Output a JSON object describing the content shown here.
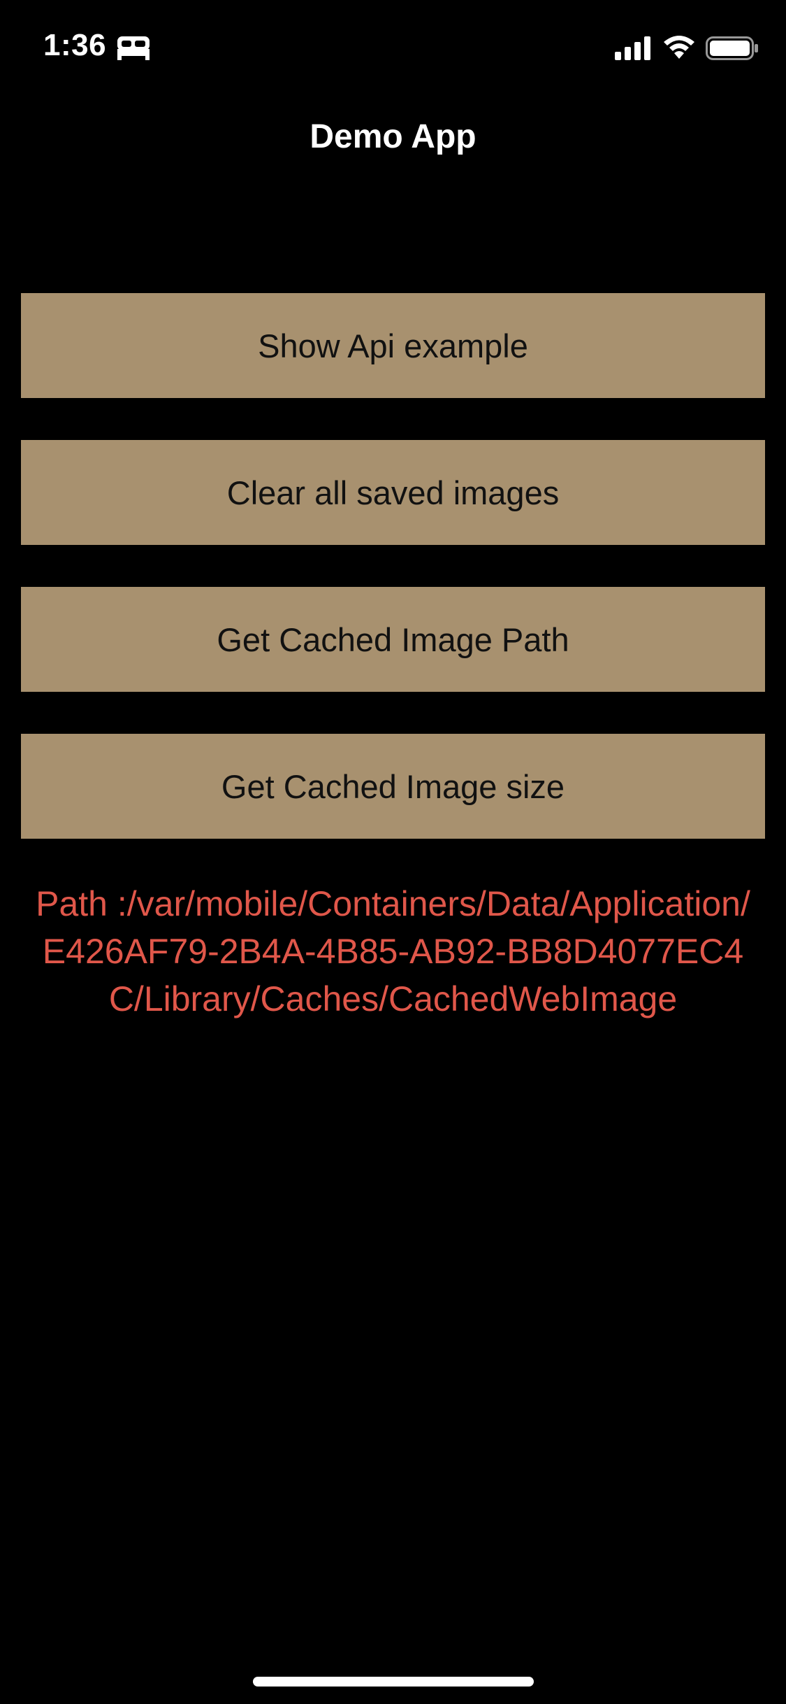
{
  "status_bar": {
    "time": "1:36",
    "icons": [
      "bed-icon",
      "cellular-signal-icon",
      "wifi-icon",
      "battery-icon"
    ]
  },
  "nav": {
    "title": "Demo App"
  },
  "buttons": [
    {
      "label": "Show Api example"
    },
    {
      "label": "Clear all saved images"
    },
    {
      "label": "Get Cached Image Path"
    },
    {
      "label": "Get Cached Image size"
    }
  ],
  "result": {
    "path_text": "Path :/var/mobile/Containers/Data/Application/E426AF79-2B4A-4B85-AB92-BB8D4077EC4C/Library/Caches/CachedWebImage"
  },
  "colors": {
    "background": "#000000",
    "button_background": "#a8916f",
    "button_text": "#111111",
    "path_text": "#e0574a"
  }
}
